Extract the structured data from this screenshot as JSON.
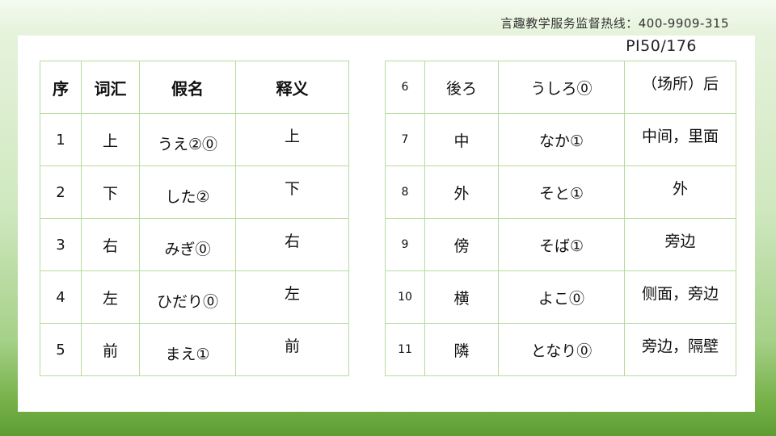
{
  "hotline": "言趣教学服务监督热线：400-9909-315",
  "page_number": "PI50/176",
  "left_table": {
    "headers": [
      "序",
      "词汇",
      "假名",
      "释义"
    ],
    "rows": [
      {
        "no": "1",
        "word": "上",
        "kana": "うえ②⓪",
        "meaning": "上"
      },
      {
        "no": "2",
        "word": "下",
        "kana": "した②",
        "meaning": "下"
      },
      {
        "no": "3",
        "word": "右",
        "kana": "みぎ⓪",
        "meaning": "右"
      },
      {
        "no": "4",
        "word": "左",
        "kana": "ひだり⓪",
        "meaning": "左"
      },
      {
        "no": "5",
        "word": "前",
        "kana": "まえ①",
        "meaning": "前"
      }
    ]
  },
  "right_table": {
    "rows": [
      {
        "no": "6",
        "word": "後ろ",
        "kana": "うしろ⓪",
        "meaning": "（场所）后"
      },
      {
        "no": "7",
        "word": "中",
        "kana": "なか①",
        "meaning": "中间，里面"
      },
      {
        "no": "8",
        "word": "外",
        "kana": "そと①",
        "meaning": "外"
      },
      {
        "no": "9",
        "word": "傍",
        "kana": "そば①",
        "meaning": "旁边"
      },
      {
        "no": "10",
        "word": "横",
        "kana": "よこ⓪",
        "meaning": "侧面，旁边"
      },
      {
        "no": "11",
        "word": "隣",
        "kana": "となり⓪",
        "meaning": "旁边，隔壁"
      }
    ]
  },
  "colors": {
    "table_border": "#b6db9f",
    "background_green": "#74b046"
  }
}
